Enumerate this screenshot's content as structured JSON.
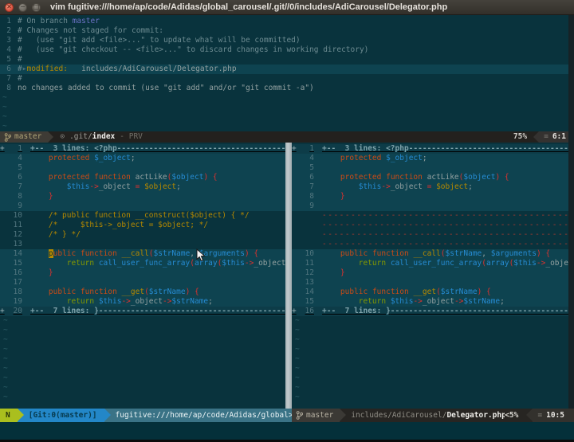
{
  "colors": {
    "background": "#09333d",
    "background_highlight": "#0e4350",
    "fold_background": "#0d3c48",
    "keyword_orange": "#cb4b16",
    "variable_blue": "#268bd2",
    "operator_red": "#dc322f",
    "literal_yellow": "#b58900",
    "return_green": "#859900",
    "base_text": "#93a1a1",
    "comment_text": "#6d8b91",
    "filler_red": "#a83a30",
    "mode_segment": "#aabf1e",
    "git_segment": "#2387c8",
    "file_segment": "#3a7386",
    "scrollbar": "#b7c1c4"
  },
  "window": {
    "title": "vim fugitive:///home/ap/code/Adidas/global_carousel/.git//0/includes/AdiCarousel/Delegator.php"
  },
  "status_buffer": {
    "tildes": 4,
    "lines": [
      {
        "num": "1",
        "tokens": [
          [
            "# On branch ",
            "c"
          ],
          [
            "master",
            "br"
          ]
        ]
      },
      {
        "num": "2",
        "tokens": [
          [
            "# Changes not staged for commit:",
            "c"
          ]
        ]
      },
      {
        "num": "3",
        "tokens": [
          [
            "#   (use \"git add <file>...\" to update what will be committed)",
            "c"
          ]
        ]
      },
      {
        "num": "4",
        "tokens": [
          [
            "#   (use \"git checkout -- <file>...\" to discard changes in working directory)",
            "c"
          ]
        ]
      },
      {
        "num": "5",
        "tokens": [
          [
            "#",
            "c"
          ]
        ]
      },
      {
        "num": "6",
        "cursorline": true,
        "tokens": [
          [
            "#",
            "c"
          ],
          [
            "▸",
            "d"
          ],
          [
            "modified:",
            "y"
          ],
          [
            "   ",
            "b"
          ],
          [
            "includes/AdiCarousel/Delegator.php",
            "b"
          ]
        ]
      },
      {
        "num": "7",
        "tokens": [
          [
            "#",
            "c"
          ]
        ]
      },
      {
        "num": "8",
        "tokens": [
          [
            "no changes added to commit (use \"git add\" and/or \"git commit -a\")",
            "b"
          ]
        ]
      }
    ]
  },
  "statusline_top": {
    "branch": "master",
    "buffer_icon": "⊙",
    "path": ".git/",
    "file": "index",
    "flag": "- PRV",
    "percent": "75%",
    "lines_icon": "≡",
    "position": "6:1"
  },
  "panes": {
    "left": {
      "tildes": 9,
      "rows": [
        {
          "type": "fold",
          "num": "1",
          "text": "+--  3 lines: <?php"
        },
        {
          "type": "code",
          "num": "4",
          "bg": "lite",
          "tokens": [
            [
              "    ",
              "b"
            ],
            [
              "protected",
              "k"
            ],
            [
              " ",
              "b"
            ],
            [
              "$_object",
              "v"
            ],
            [
              ";",
              "b"
            ]
          ]
        },
        {
          "type": "blank",
          "num": "5",
          "bg": "lite"
        },
        {
          "type": "code",
          "num": "6",
          "bg": "lite",
          "tokens": [
            [
              "    ",
              "b"
            ],
            [
              "protected",
              "k"
            ],
            [
              " ",
              "b"
            ],
            [
              "function",
              "k"
            ],
            [
              " ",
              "b"
            ],
            [
              "actLike",
              "b"
            ],
            [
              "(",
              "o"
            ],
            [
              "$object",
              "v"
            ],
            [
              ")",
              "o"
            ],
            [
              " ",
              "b"
            ],
            [
              "{",
              "o"
            ]
          ]
        },
        {
          "type": "code",
          "num": "7",
          "bg": "lite",
          "tokens": [
            [
              "        ",
              "b"
            ],
            [
              "$this",
              "v"
            ],
            [
              "->",
              "o"
            ],
            [
              "_object",
              "b"
            ],
            [
              " ",
              "b"
            ],
            [
              "=",
              "o"
            ],
            [
              " ",
              "b"
            ],
            [
              "$object",
              "y"
            ],
            [
              ";",
              "b"
            ]
          ]
        },
        {
          "type": "code",
          "num": "8",
          "bg": "lite",
          "tokens": [
            [
              "    ",
              "b"
            ],
            [
              "}",
              "o"
            ]
          ]
        },
        {
          "type": "blank",
          "num": "9",
          "bg": "lite"
        },
        {
          "type": "code",
          "num": "10",
          "tokens": [
            [
              "    ",
              "b"
            ],
            [
              "/* public function __construct($object) { */",
              "y"
            ]
          ]
        },
        {
          "type": "code",
          "num": "11",
          "tokens": [
            [
              "    ",
              "b"
            ],
            [
              "/*     $this->_object = $object; */",
              "y"
            ]
          ]
        },
        {
          "type": "code",
          "num": "12",
          "tokens": [
            [
              "    ",
              "b"
            ],
            [
              "/* } */",
              "y"
            ]
          ]
        },
        {
          "type": "blank",
          "num": "13"
        },
        {
          "type": "code",
          "num": "14",
          "bg": "lite",
          "tokens": [
            [
              "    ",
              "b"
            ],
            [
              "p",
              "cur"
            ],
            [
              "ublic",
              "k"
            ],
            [
              " ",
              "b"
            ],
            [
              "function",
              "k"
            ],
            [
              " ",
              "b"
            ],
            [
              "__call",
              "y"
            ],
            [
              "(",
              "o"
            ],
            [
              "$strName",
              "v"
            ],
            [
              ", ",
              "b"
            ],
            [
              "$arguments",
              "v"
            ],
            [
              ")",
              "o"
            ],
            [
              " ",
              "b"
            ],
            [
              "{",
              "o"
            ]
          ]
        },
        {
          "type": "code",
          "num": "15",
          "bg": "lite",
          "tokens": [
            [
              "        ",
              "b"
            ],
            [
              "return",
              "g"
            ],
            [
              " ",
              "b"
            ],
            [
              "call_user_func_array",
              "v"
            ],
            [
              "(",
              "o"
            ],
            [
              "array",
              "v"
            ],
            [
              "(",
              "o"
            ],
            [
              "$this",
              "v"
            ],
            [
              "->",
              "o"
            ],
            [
              "_object",
              "b"
            ],
            [
              ",",
              "b"
            ]
          ]
        },
        {
          "type": "code",
          "num": "16",
          "bg": "lite",
          "tokens": [
            [
              "    ",
              "b"
            ],
            [
              "}",
              "o"
            ]
          ]
        },
        {
          "type": "blank",
          "num": "17",
          "bg": "lite"
        },
        {
          "type": "code",
          "num": "18",
          "bg": "lite",
          "tokens": [
            [
              "    ",
              "b"
            ],
            [
              "public",
              "k"
            ],
            [
              " ",
              "b"
            ],
            [
              "function",
              "k"
            ],
            [
              " ",
              "b"
            ],
            [
              "__get",
              "y"
            ],
            [
              "(",
              "o"
            ],
            [
              "$strName",
              "v"
            ],
            [
              ")",
              "o"
            ],
            [
              " ",
              "b"
            ],
            [
              "{",
              "o"
            ]
          ]
        },
        {
          "type": "code",
          "num": "19",
          "bg": "lite",
          "tokens": [
            [
              "        ",
              "b"
            ],
            [
              "return",
              "g"
            ],
            [
              " ",
              "b"
            ],
            [
              "$this",
              "v"
            ],
            [
              "->",
              "o"
            ],
            [
              "_object",
              "b"
            ],
            [
              "->",
              "o"
            ],
            [
              "$strName",
              "v"
            ],
            [
              ";",
              "b"
            ]
          ]
        },
        {
          "type": "fold",
          "num": "20",
          "text": "+--  7 lines: }"
        }
      ]
    },
    "right": {
      "tildes": 9,
      "rows": [
        {
          "type": "fold",
          "num": "1",
          "text": "+--  3 lines: <?php"
        },
        {
          "type": "code",
          "num": "4",
          "bg": "lite",
          "tokens": [
            [
              "    ",
              "b"
            ],
            [
              "protected",
              "k"
            ],
            [
              " ",
              "b"
            ],
            [
              "$_object",
              "v"
            ],
            [
              ";",
              "b"
            ]
          ]
        },
        {
          "type": "blank",
          "num": "5",
          "bg": "lite"
        },
        {
          "type": "code",
          "num": "6",
          "bg": "lite",
          "tokens": [
            [
              "    ",
              "b"
            ],
            [
              "protected",
              "k"
            ],
            [
              " ",
              "b"
            ],
            [
              "function",
              "k"
            ],
            [
              " ",
              "b"
            ],
            [
              "actLike",
              "b"
            ],
            [
              "(",
              "o"
            ],
            [
              "$object",
              "v"
            ],
            [
              ")",
              "o"
            ],
            [
              " ",
              "b"
            ],
            [
              "{",
              "o"
            ]
          ]
        },
        {
          "type": "code",
          "num": "7",
          "bg": "lite",
          "tokens": [
            [
              "        ",
              "b"
            ],
            [
              "$this",
              "v"
            ],
            [
              "->",
              "o"
            ],
            [
              "_object",
              "b"
            ],
            [
              " ",
              "b"
            ],
            [
              "=",
              "o"
            ],
            [
              " ",
              "b"
            ],
            [
              "$object",
              "y"
            ],
            [
              ";",
              "b"
            ]
          ]
        },
        {
          "type": "code",
          "num": "8",
          "bg": "lite",
          "tokens": [
            [
              "    ",
              "b"
            ],
            [
              "}",
              "o"
            ]
          ]
        },
        {
          "type": "blank",
          "num": "9",
          "bg": "lite"
        },
        {
          "type": "filler"
        },
        {
          "type": "filler"
        },
        {
          "type": "filler"
        },
        {
          "type": "filler"
        },
        {
          "type": "code",
          "num": "10",
          "bg": "lite",
          "tokens": [
            [
              "    ",
              "b"
            ],
            [
              "public",
              "k"
            ],
            [
              " ",
              "b"
            ],
            [
              "function",
              "k"
            ],
            [
              " ",
              "b"
            ],
            [
              "__call",
              "y"
            ],
            [
              "(",
              "o"
            ],
            [
              "$strName",
              "v"
            ],
            [
              ", ",
              "b"
            ],
            [
              "$arguments",
              "v"
            ],
            [
              ")",
              "o"
            ],
            [
              " ",
              "b"
            ],
            [
              "{",
              "o"
            ]
          ]
        },
        {
          "type": "code",
          "num": "11",
          "bg": "lite",
          "tokens": [
            [
              "        ",
              "b"
            ],
            [
              "return",
              "g"
            ],
            [
              " ",
              "b"
            ],
            [
              "call_user_func_array",
              "v"
            ],
            [
              "(",
              "o"
            ],
            [
              "array",
              "v"
            ],
            [
              "(",
              "o"
            ],
            [
              "$this",
              "v"
            ],
            [
              "->",
              "o"
            ],
            [
              "_object",
              "b"
            ],
            [
              ",",
              "b"
            ]
          ]
        },
        {
          "type": "code",
          "num": "12",
          "bg": "lite",
          "tokens": [
            [
              "    ",
              "b"
            ],
            [
              "}",
              "o"
            ]
          ]
        },
        {
          "type": "blank",
          "num": "13",
          "bg": "lite"
        },
        {
          "type": "code",
          "num": "14",
          "bg": "lite",
          "tokens": [
            [
              "    ",
              "b"
            ],
            [
              "public",
              "k"
            ],
            [
              " ",
              "b"
            ],
            [
              "function",
              "k"
            ],
            [
              " ",
              "b"
            ],
            [
              "__get",
              "y"
            ],
            [
              "(",
              "o"
            ],
            [
              "$strName",
              "v"
            ],
            [
              ")",
              "o"
            ],
            [
              " ",
              "b"
            ],
            [
              "{",
              "o"
            ]
          ]
        },
        {
          "type": "code",
          "num": "15",
          "bg": "lite",
          "tokens": [
            [
              "        ",
              "b"
            ],
            [
              "return",
              "g"
            ],
            [
              " ",
              "b"
            ],
            [
              "$this",
              "v"
            ],
            [
              "->",
              "o"
            ],
            [
              "_object",
              "b"
            ],
            [
              "->",
              "o"
            ],
            [
              "$strName",
              "v"
            ],
            [
              ";",
              "b"
            ]
          ]
        },
        {
          "type": "fold",
          "num": "16",
          "text": "+--  7 lines: }"
        }
      ]
    }
  },
  "statusline_left": {
    "mode": "N",
    "git": "[Git:0(master)]",
    "path": "fugitive:///home/ap/code/Adidas/global>"
  },
  "statusline_right": {
    "branch": "master",
    "path": "includes/AdiCarousel/",
    "file": "Delegator.php",
    "percent": "<5%",
    "lines_icon": "≡",
    "position": "10:5"
  }
}
